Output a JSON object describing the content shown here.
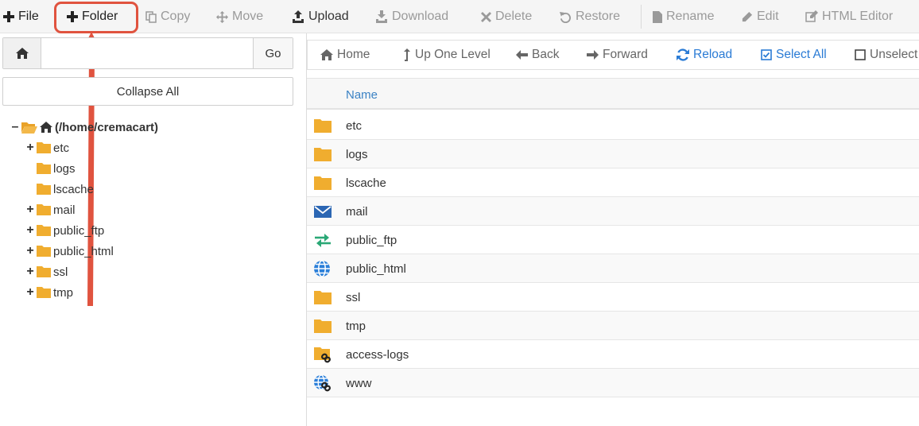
{
  "toolbar": {
    "file": "File",
    "folder": "Folder",
    "copy": "Copy",
    "move": "Move",
    "upload": "Upload",
    "download": "Download",
    "delete": "Delete",
    "restore": "Restore",
    "rename": "Rename",
    "edit": "Edit",
    "html_editor": "HTML Editor"
  },
  "colors": {
    "folder": "#f0ad2f",
    "link_blue": "#2a7bd5",
    "highlight": "#e0533f",
    "mail": "#2b66b3",
    "ftp": "#2aa876"
  },
  "left_panel": {
    "path_input_value": "",
    "go": "Go",
    "collapse_all": "Collapse All",
    "tree": [
      {
        "toggle": "–",
        "label": "(/home/cremacart)",
        "icon": "folder-open-icon"
      },
      {
        "toggle": "+",
        "label": "etc",
        "icon": "folder-icon"
      },
      {
        "toggle": "",
        "label": "logs",
        "icon": "folder-icon"
      },
      {
        "toggle": "",
        "label": "lscache",
        "icon": "folder-icon"
      },
      {
        "toggle": "+",
        "label": "mail",
        "icon": "folder-icon"
      },
      {
        "toggle": "+",
        "label": "public_ftp",
        "icon": "folder-icon"
      },
      {
        "toggle": "+",
        "label": "public_html",
        "icon": "folder-icon"
      },
      {
        "toggle": "+",
        "label": "ssl",
        "icon": "folder-icon"
      },
      {
        "toggle": "+",
        "label": "tmp",
        "icon": "folder-icon"
      }
    ]
  },
  "nav": {
    "home": "Home",
    "up_one_level": "Up One Level",
    "back": "Back",
    "forward": "Forward",
    "reload": "Reload",
    "select_all": "Select All",
    "unselect": "Unselect"
  },
  "files": {
    "header_name": "Name",
    "rows": [
      {
        "name": "etc",
        "icon": "folder-icon"
      },
      {
        "name": "logs",
        "icon": "folder-icon"
      },
      {
        "name": "lscache",
        "icon": "folder-icon"
      },
      {
        "name": "mail",
        "icon": "mail-icon"
      },
      {
        "name": "public_ftp",
        "icon": "ftp-arrows-icon"
      },
      {
        "name": "public_html",
        "icon": "globe-icon"
      },
      {
        "name": "ssl",
        "icon": "folder-icon"
      },
      {
        "name": "tmp",
        "icon": "folder-icon"
      },
      {
        "name": "access-logs",
        "icon": "folder-link-icon"
      },
      {
        "name": "www",
        "icon": "globe-link-icon"
      }
    ]
  }
}
